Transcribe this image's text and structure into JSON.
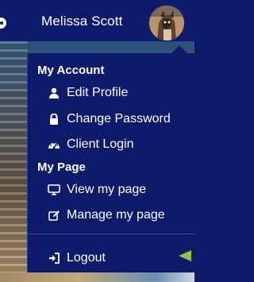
{
  "header": {
    "user_name": "Melissa Scott",
    "avatar_icon": "user-avatar-photo"
  },
  "menu": {
    "sections": [
      {
        "heading": "My Account",
        "items": [
          {
            "label": "Edit Profile",
            "icon": "user-icon"
          },
          {
            "label": "Change Password",
            "icon": "lock-icon"
          },
          {
            "label": "Client Login",
            "icon": "dashboard-icon"
          }
        ]
      },
      {
        "heading": "My Page",
        "items": [
          {
            "label": "View my page",
            "icon": "desktop-icon"
          },
          {
            "label": "Manage my page",
            "icon": "edit-icon"
          }
        ]
      }
    ],
    "logout_label": "Logout",
    "logout_icon": "sign-out-icon"
  },
  "colors": {
    "nav_background": "#0e1a6a",
    "text": "#ffffff",
    "pointer_arrow": "#8cc63f"
  }
}
